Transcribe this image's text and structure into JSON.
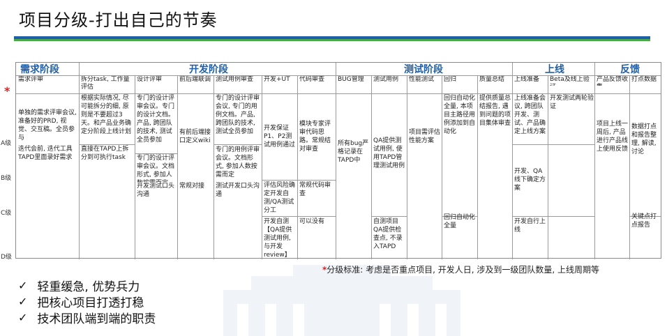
{
  "page": {
    "title": "项目分级-打出自己的节奏"
  },
  "phases": {
    "demand": "需求阶段",
    "dev": "开发阶段",
    "test": "测试阶段",
    "launch": "上线",
    "feedback": "反馈"
  },
  "subheaders": {
    "demand_review": "需求评审",
    "split_task": "拆分task, 工作量评估",
    "design_review": "设计评审",
    "api_sync": "前后端联调",
    "test_case_review": "测试用例审查",
    "dev_ut": "开发+UT",
    "code_review": "代码审查",
    "bug_mgmt": "BUG管理",
    "test_case": "测试用例",
    "perf_test": "性能测试",
    "regression": "回归",
    "quality_summary": "质量总结",
    "launch_prep": "上线准备",
    "beta": "Beta及线上验证",
    "product_feedback": "产品反馈收集",
    "tracking": "打点数据"
  },
  "levels": {
    "marker": "*",
    "a": "A级",
    "b": "B级",
    "c": "C级",
    "d": "D级"
  },
  "cells": {
    "demand_a": "单独的需求评审会议, 准备好的PRD, 视觉、交互稿。全员参与",
    "demand_b": "迭代会前, 迭代工具TAPD里面录好需求",
    "split_a": "根据实际情况, 尽可能拆分的细, 原则是不要超过3天。和产品业务确定分阶段上线计划",
    "split_b": "直接在TAPD上拆分到可执行task",
    "design_a": "专门的设计评审会议。专门的设计文档。产品, 跨团队的技术, 测试全员参加",
    "design_b": "专门的设计评审会议。文档形式, 参加人数按需而定",
    "design_c": "开发测试口头沟通",
    "api_a": "有前后端接口定义wiki",
    "api_c": "常规对接",
    "tcr_a": "专门的设计评审会议, 专门的用例文档。产品, 跨团队的技术, 测试全员参加",
    "tcr_b": "专门的用例评审会议。文档形式, 参加人数按需而定",
    "tcr_c": "测试开发口头沟通",
    "devut_a": "开发保证P1、P2测试用例通过",
    "devut_c": "评估风险确定开发自测/QA测试分工",
    "devut_d": "开发自测【QA提供测试用例, 与开发review】",
    "code_a": "模块专家评审代码思路。常规结对审查",
    "code_c": "常规代码审查",
    "code_d": "可以没有",
    "bug_a": "所有bug严格记录在TAPD中",
    "tc_a": "QA提供测试用例, 使用TAPD管理测试用例",
    "tc_d": "自测项目QA提供检查点, 不录入TAPD",
    "perf_a": "项目需评估性能方案",
    "reg_a": "回归自动化全量, 本项目主路径用例添加到自动化",
    "reg_d": "回归自动化全量",
    "qs_a": "提供质量总结报告, 遇到问题的项目集体审查",
    "lp_a": "上线准备会议, 跨团队开发、测试、产品确定上线方案",
    "lp_b": "开发、QA线下确定方案",
    "lp_d": "开发自行上线",
    "beta_a": "开发测试两轮验证",
    "pf_a": "项目上线一周后, 产品进行产品线上使用反馈",
    "track_a": "数据打点和报告整理, 解读, 讨论",
    "track_d": "关键点打点报告"
  },
  "footnote": {
    "star": "*",
    "text": "分级标准: 考虑是否重点项目, 开发人日, 涉及到一级团队数量, 上线周期等"
  },
  "bullets": [
    "轻重缓急, 优势兵力",
    "把核心项目打透打稳",
    "技术团队端到端的职责"
  ],
  "colors": {
    "accent_blue": "#1f5fa8",
    "accent_green": "#4aa84a",
    "marker_red": "#e02020"
  }
}
